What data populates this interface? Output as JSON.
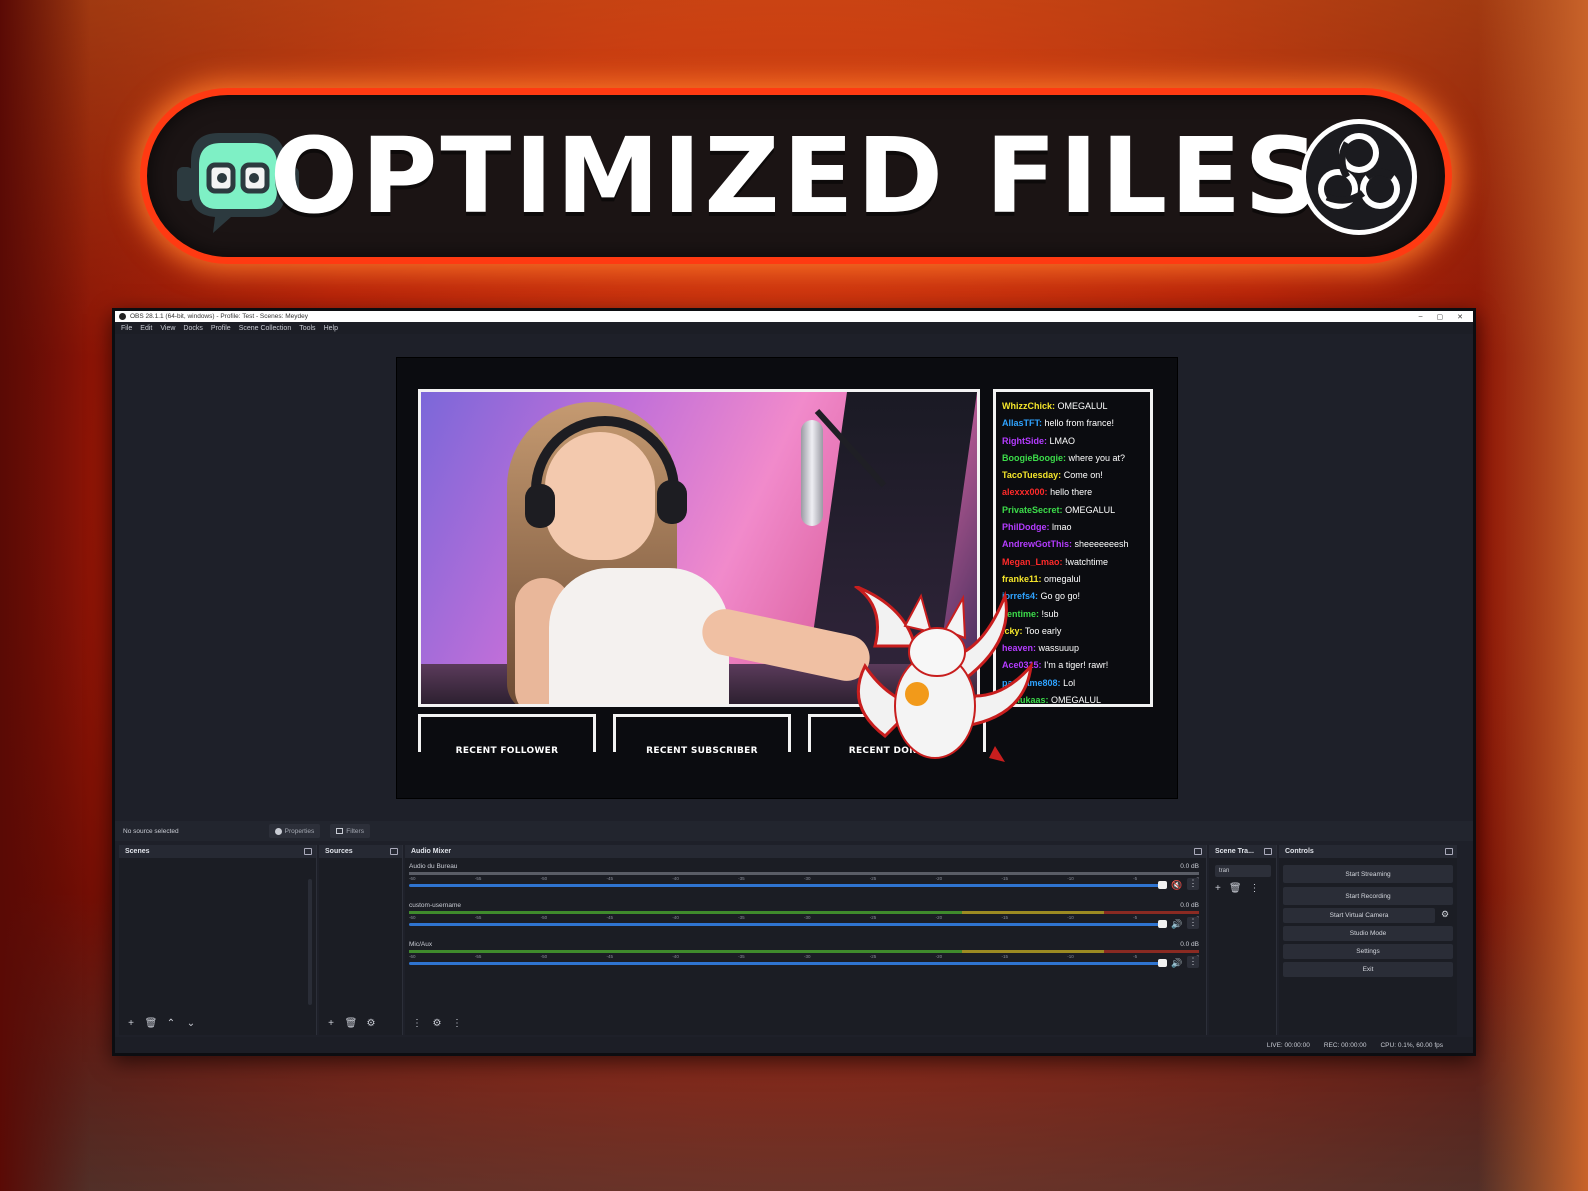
{
  "banner": {
    "title": "OPTIMIZED FILES"
  },
  "window": {
    "title": "OBS 28.1.1 (64-bit, windows) - Profile: Test - Scenes: Meydey",
    "controls": [
      "–",
      "▢",
      "✕"
    ],
    "menu": [
      "File",
      "Edit",
      "View",
      "Docks",
      "Profile",
      "Scene Collection",
      "Tools",
      "Help"
    ]
  },
  "preview": {
    "chat": [
      {
        "user": "WhizzChick:",
        "msg": "OMEGALUL",
        "color": "#f5e62b"
      },
      {
        "user": "AllasTFT:",
        "msg": "hello from france!",
        "color": "#2fa3ff"
      },
      {
        "user": "RightSide:",
        "msg": "LMAO",
        "color": "#b43cff"
      },
      {
        "user": "BoogieBoogie:",
        "msg": "where you at?",
        "color": "#3cdb4a"
      },
      {
        "user": "TacoTuesday:",
        "msg": "Come on!",
        "color": "#f5e62b"
      },
      {
        "user": "alexxx000:",
        "msg": "hello there",
        "color": "#ff2a2a"
      },
      {
        "user": "PrivateSecret:",
        "msg": "OMEGALUL",
        "color": "#3cdb4a"
      },
      {
        "user": "PhilDodge:",
        "msg": "lmao",
        "color": "#b43cff"
      },
      {
        "user": "AndrewGotThis:",
        "msg": "sheeeeeeesh",
        "color": "#b43cff"
      },
      {
        "user": "Megan_Lmao:",
        "msg": "!watchtime",
        "color": "#ff2a2a"
      },
      {
        "user": "franke11:",
        "msg": "omegalul",
        "color": "#f5e62b"
      },
      {
        "user": "jorrefs4:",
        "msg": "Go go go!",
        "color": "#2fa3ff"
      },
      {
        "user": "kentime:",
        "msg": "!sub",
        "color": "#3cdb4a"
      },
      {
        "user": "icky:",
        "msg": "Too early",
        "color": "#f5e62b"
      },
      {
        "user": "heaven:",
        "msg": "wassuuup",
        "color": "#b43cff"
      },
      {
        "user": "Ace0315:",
        "msg": "I'm a tiger! rawr!",
        "color": "#b43cff"
      },
      {
        "user": "pacGame808:",
        "msg": "Lol",
        "color": "#2fa3ff"
      },
      {
        "user": "an_lukaas:",
        "msg": "OMEGALUL",
        "color": "#3cdb4a"
      }
    ],
    "alerts": [
      "RECENT FOLLOWER",
      "RECENT SUBSCRIBER",
      "RECENT DONATOR"
    ]
  },
  "infobar": {
    "status": "No source selected",
    "properties": "Properties",
    "filters": "Filters"
  },
  "docks": {
    "scenes": "Scenes",
    "sources": "Sources",
    "mixer": "Audio Mixer",
    "transitions": "Scene Tra...",
    "controls": "Controls"
  },
  "mixer": {
    "ticks": [
      "-60",
      "-55",
      "-50",
      "-45",
      "-40",
      "-35",
      "-30",
      "-25",
      "-20",
      "-15",
      "-10",
      "-5",
      "0"
    ],
    "tracks": [
      {
        "name": "Audio du Bureau",
        "db": "0.0 dB",
        "muted": true
      },
      {
        "name": "custom-username",
        "db": "0.0 dB",
        "muted": false
      },
      {
        "name": "Mic/Aux",
        "db": "0.0 dB",
        "muted": false
      }
    ]
  },
  "transitions": {
    "selected": "tran"
  },
  "controls": {
    "start_streaming": "Start Streaming",
    "start_recording": "Start Recording",
    "start_virtual_camera": "Start Virtual Camera",
    "studio_mode": "Studio Mode",
    "settings": "Settings",
    "exit": "Exit"
  },
  "status": {
    "live": "LIVE: 00:00:00",
    "rec": "REC: 00:00:00",
    "cpu": "CPU: 0.1%, 60.00 fps"
  }
}
